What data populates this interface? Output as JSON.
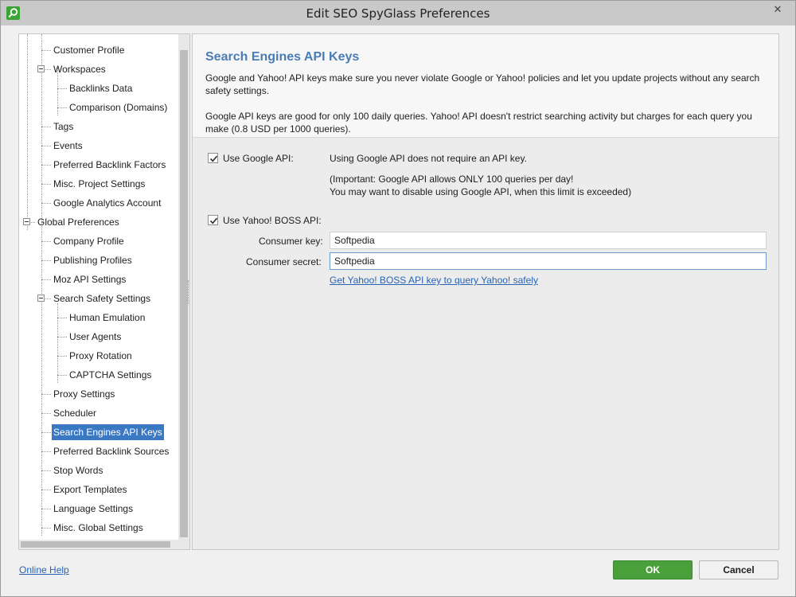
{
  "window": {
    "title": "Edit SEO SpyGlass Preferences",
    "close_glyph": "✕"
  },
  "sidebar": {
    "items": [
      {
        "label": "Customer Profile",
        "level": 2
      },
      {
        "label": "Workspaces",
        "level": 2,
        "expanded": true
      },
      {
        "label": "Backlinks Data",
        "level": 3
      },
      {
        "label": "Comparison (Domains)",
        "level": 3
      },
      {
        "label": "Tags",
        "level": 2
      },
      {
        "label": "Events",
        "level": 2
      },
      {
        "label": "Preferred Backlink Factors",
        "level": 2
      },
      {
        "label": "Misc. Project Settings",
        "level": 2
      },
      {
        "label": "Google Analytics Account",
        "level": 2
      },
      {
        "label": "Global Preferences",
        "level": 1,
        "expanded": true
      },
      {
        "label": "Company Profile",
        "level": 2
      },
      {
        "label": "Publishing Profiles",
        "level": 2
      },
      {
        "label": "Moz API Settings",
        "level": 2
      },
      {
        "label": "Search Safety Settings",
        "level": 2,
        "expanded": true
      },
      {
        "label": "Human Emulation",
        "level": 3
      },
      {
        "label": "User Agents",
        "level": 3
      },
      {
        "label": "Proxy Rotation",
        "level": 3
      },
      {
        "label": "CAPTCHA Settings",
        "level": 3
      },
      {
        "label": "Proxy Settings",
        "level": 2
      },
      {
        "label": "Scheduler",
        "level": 2
      },
      {
        "label": "Search Engines API Keys",
        "level": 2,
        "selected": true
      },
      {
        "label": "Preferred Backlink Sources",
        "level": 2
      },
      {
        "label": "Stop Words",
        "level": 2
      },
      {
        "label": "Export Templates",
        "level": 2
      },
      {
        "label": "Language Settings",
        "level": 2
      },
      {
        "label": "Misc. Global Settings",
        "level": 2
      }
    ]
  },
  "main": {
    "title": "Search Engines API Keys",
    "description1": "Google and Yahoo! API keys make sure you never violate Google or Yahoo! policies and let you update projects without any search safety settings.",
    "description2": "Google API keys are good for only 100 daily queries. Yahoo! API doesn't restrict searching activity but charges for each query you make (0.8 USD per 1000 queries).",
    "google": {
      "checkbox_label": "Use Google API:",
      "checked": true,
      "info1": "Using Google API does not require an API key.",
      "info2": "(Important: Google API allows ONLY 100 queries per day!",
      "info3": "You may want to disable using Google API, when this limit is exceeded)"
    },
    "yahoo": {
      "checkbox_label": "Use Yahoo! BOSS API:",
      "checked": true,
      "consumer_key_label": "Consumer key:",
      "consumer_key_value": "Softpedia",
      "consumer_secret_label": "Consumer secret:",
      "consumer_secret_value": "Softpedia",
      "get_key_link": "Get Yahoo! BOSS API key to query Yahoo! safely"
    }
  },
  "footer": {
    "help_link": "Online Help",
    "ok_label": "OK",
    "cancel_label": "Cancel"
  },
  "colors": {
    "accent": "#4a7cb5",
    "selection": "#3b78c4",
    "ok_button": "#4aa13c",
    "link": "#2a63b2"
  }
}
